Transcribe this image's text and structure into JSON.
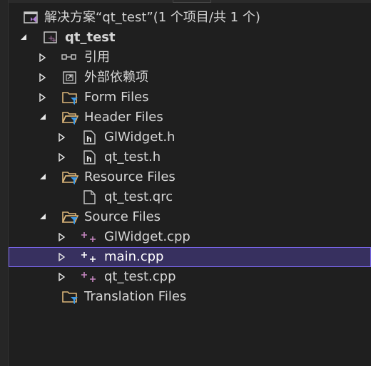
{
  "solution": {
    "label": "解决方案“qt_test”(1 个项目/共 1 个)"
  },
  "project": {
    "label": "qt_test"
  },
  "nodes": {
    "references": "引用",
    "external_deps": "外部依赖项",
    "form_files": "Form Files",
    "header_files": "Header Files",
    "glwidget_h": "GlWidget.h",
    "qt_test_h": "qt_test.h",
    "resource_files": "Resource Files",
    "qt_test_qrc": "qt_test.qrc",
    "source_files": "Source Files",
    "glwidget_cpp": "GlWidget.cpp",
    "main_cpp": "main.cpp",
    "qt_test_cpp": "qt_test.cpp",
    "translation_files": "Translation Files"
  },
  "colors": {
    "background": "#1f1f1f",
    "selection_fill": "#37305f",
    "selection_border": "#7b68ee",
    "folder": "#dcb67a",
    "filter_funnel": "#3c9ae8",
    "cpp_plus": "#c586c0"
  }
}
